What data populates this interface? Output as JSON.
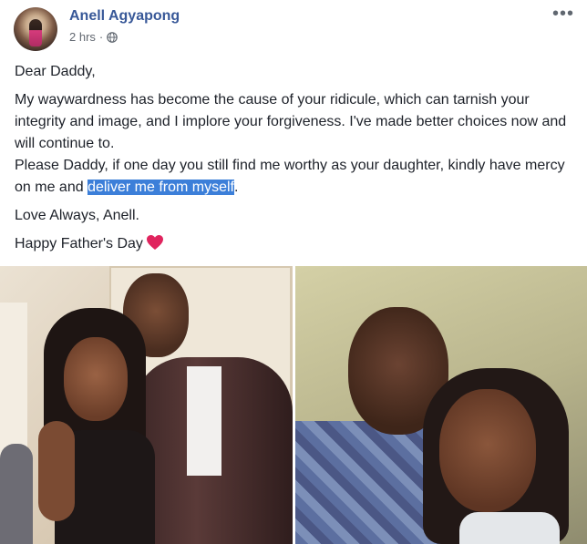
{
  "post": {
    "author": "Anell Agyapong",
    "time": "2 hrs",
    "time_separator": "·",
    "privacy_icon": "globe-icon",
    "more_icon": "more-options-icon",
    "more_glyph": "•••"
  },
  "message": {
    "greeting": "Dear Daddy,",
    "paragraph1": "My waywardness has become the cause of your ridicule, which can tarnish your integrity and image, and I implore your forgiveness. I've made better choices now and will continue to.",
    "paragraph2_before": "Please Daddy, if one day you still find me worthy as your daughter, kindly have mercy on me and ",
    "paragraph2_highlight": "deliver me from myself",
    "paragraph2_after": ".",
    "signoff": "Love Always, Anell.",
    "closing": "Happy Father's Day",
    "closing_emoji": "red-heart-icon"
  },
  "colors": {
    "author_link": "#385898",
    "selection_highlight": "#3c7fd9",
    "heart": "#e0245e"
  },
  "photos": [
    {
      "name": "photo-father-daughter-formal"
    },
    {
      "name": "photo-father-daughter-closeup"
    }
  ]
}
